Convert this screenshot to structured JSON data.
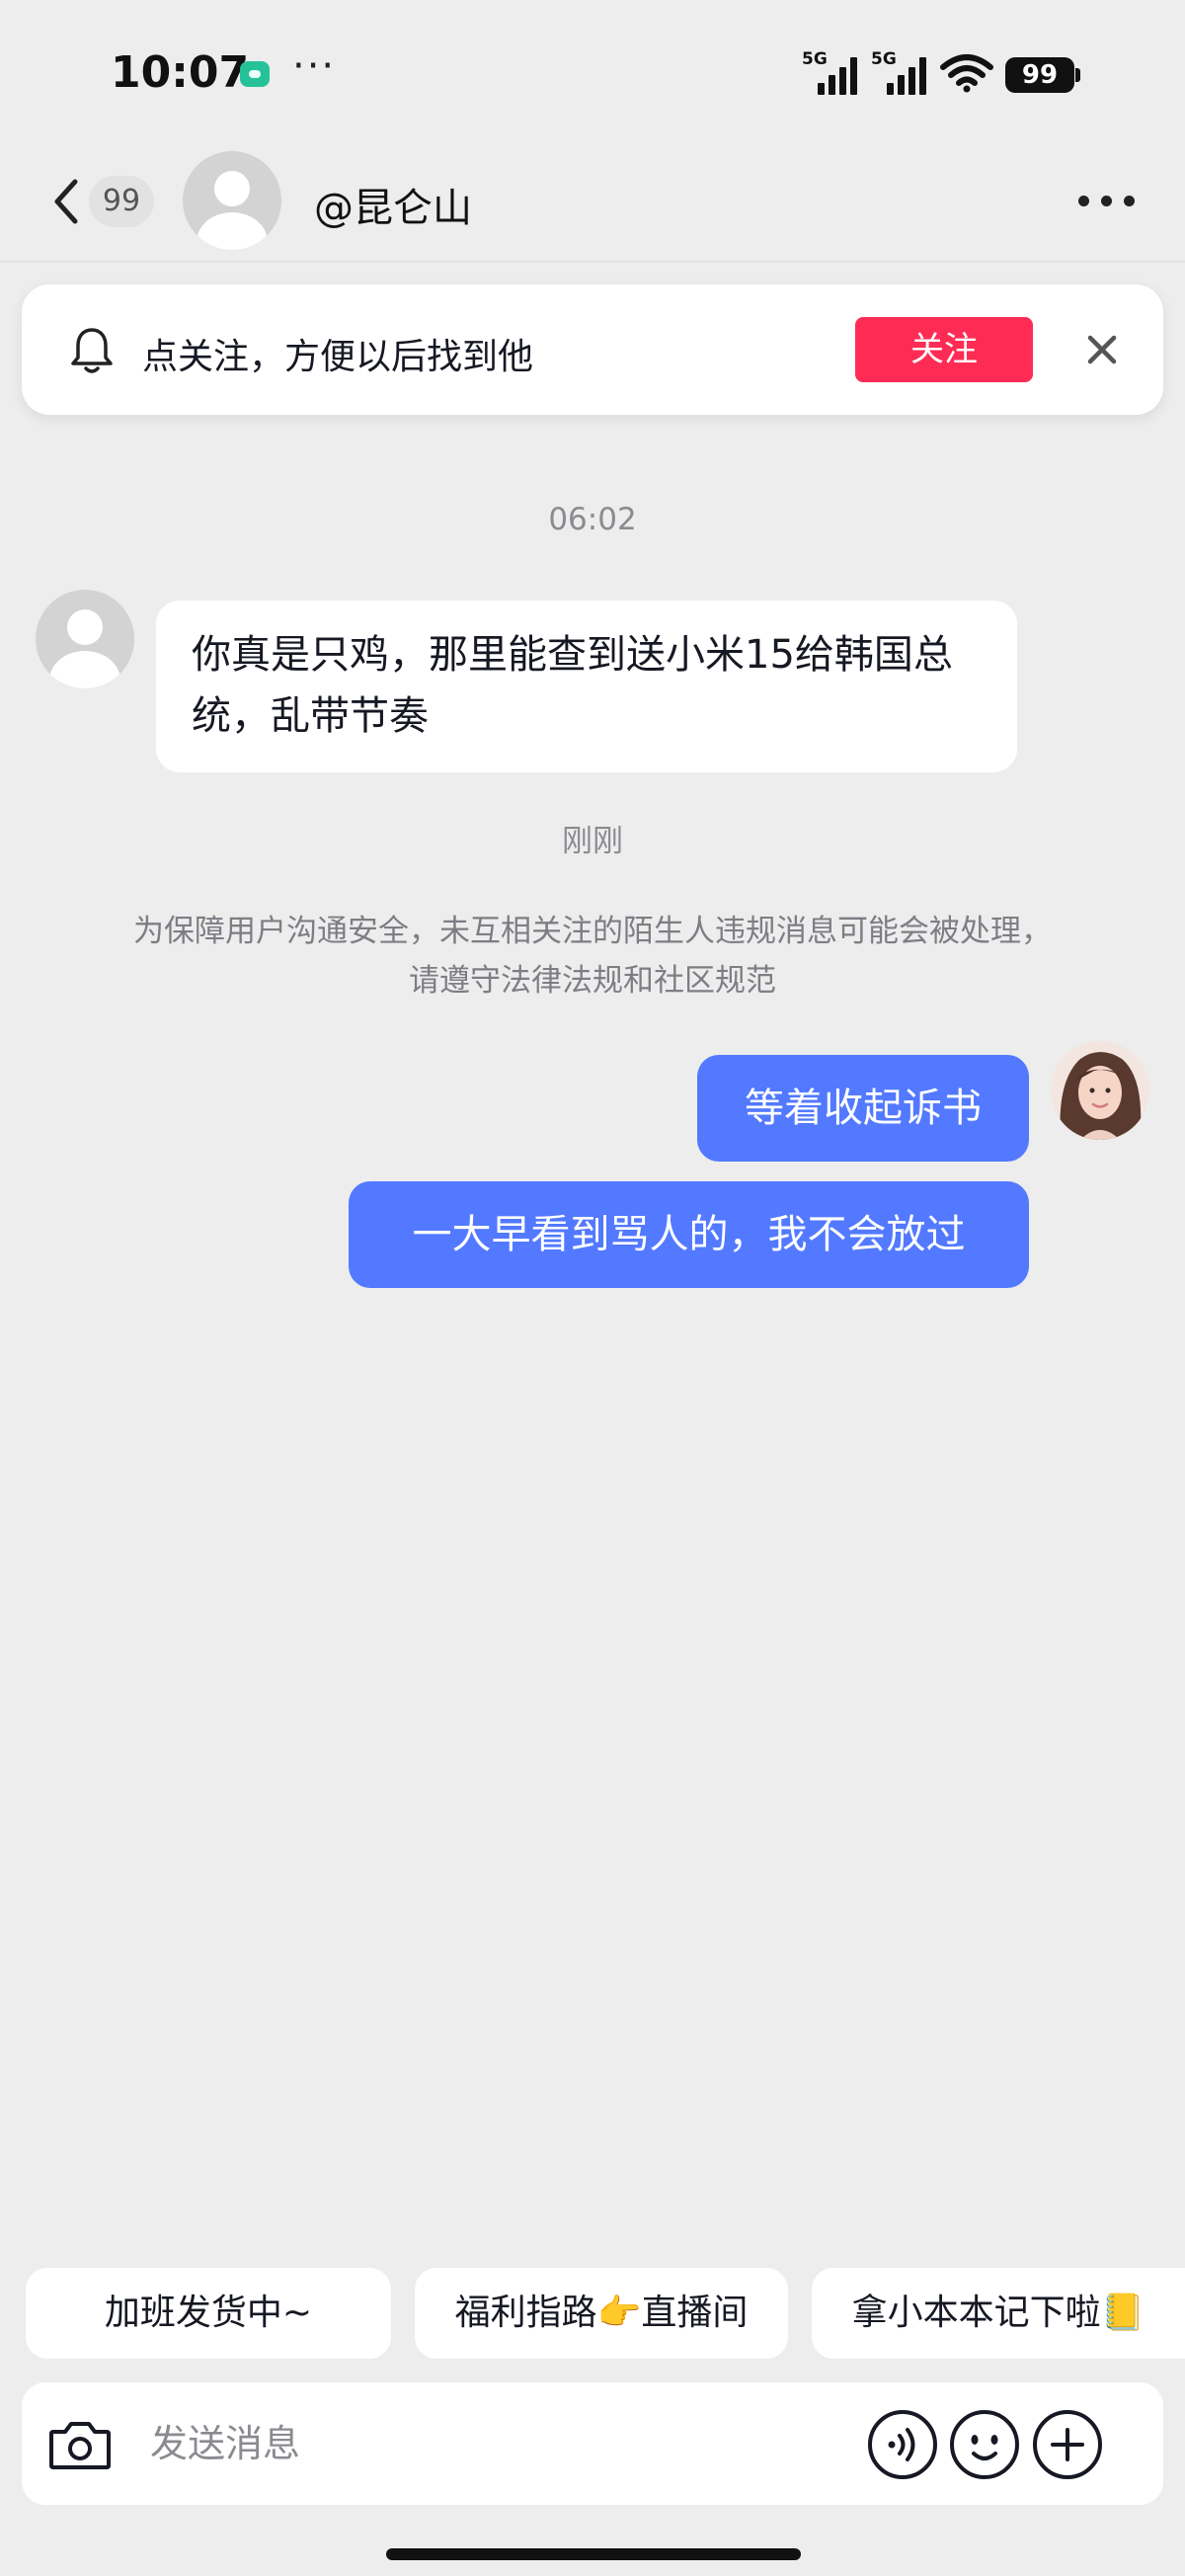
{
  "status_bar": {
    "time": "10:07",
    "dots": "···",
    "network": [
      "5G",
      "5G"
    ],
    "battery": "99",
    "icons": [
      "wechat-icon",
      "signal-icon",
      "wifi-icon",
      "battery-icon"
    ]
  },
  "header": {
    "unread_count": "99",
    "contact_name": "@昆仑山",
    "icons": [
      "back-icon",
      "more-icon"
    ]
  },
  "follow_banner": {
    "text": "点关注，方便以后找到他",
    "button_label": "关注",
    "icons": [
      "bell-icon",
      "close-icon"
    ]
  },
  "chat": {
    "timestamp_1": "06:02",
    "incoming_message": "你真是只鸡，那里能查到送小米15给韩国总统，乱带节奏",
    "timestamp_2": "刚刚",
    "safety_notice": "为保障用户沟通安全，未互相关注的陌生人违规消息可能会被处理，请遵守法律法规和社区规范",
    "outgoing_messages": [
      "等着收起诉书",
      "一大早看到骂人的，我不会放过"
    ]
  },
  "quick_replies": [
    "加班发货中~",
    "福利指路👉直播间",
    "拿小本本记下啦📒"
  ],
  "composer": {
    "placeholder": "发送消息",
    "icons": [
      "camera-icon",
      "voice-icon",
      "emoji-icon",
      "plus-icon"
    ]
  },
  "colors": {
    "accent_red": "#fe2c55",
    "outgoing_bubble": "#5279ff",
    "background": "#ededed"
  }
}
